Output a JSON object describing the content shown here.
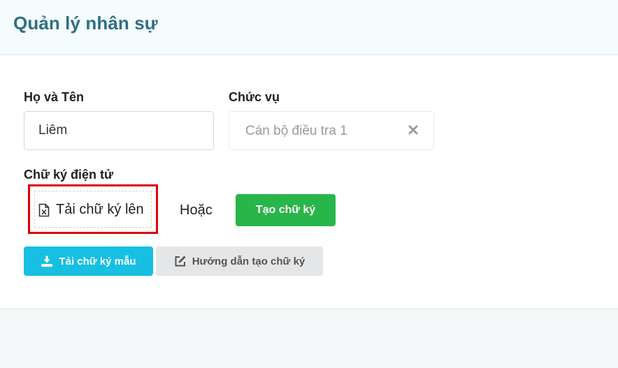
{
  "header": {
    "title": "Quản lý nhân sự"
  },
  "form": {
    "name_label": "Họ và Tên",
    "name_value": "Liêm",
    "position_label": "Chức vụ",
    "position_value": "Cán bộ điều tra 1",
    "signature_label": "Chữ ký điện tử",
    "upload_label": "Tải chữ ký lên",
    "or_text": "Hoặc",
    "create_button": "Tạo chữ ký",
    "download_sample_button": "Tải chữ ký mẫu",
    "guide_button": "Hướng dẫn tạo chữ ký"
  },
  "colors": {
    "title": "#2f6f84",
    "create_button": "#28b54a",
    "download_button": "#17bfe3",
    "guide_button": "#e5e6e7",
    "highlight_border": "#e00000"
  },
  "icons": {
    "upload": "excel-file-icon",
    "clear": "close-icon",
    "download": "download-icon",
    "guide": "edit-icon"
  }
}
